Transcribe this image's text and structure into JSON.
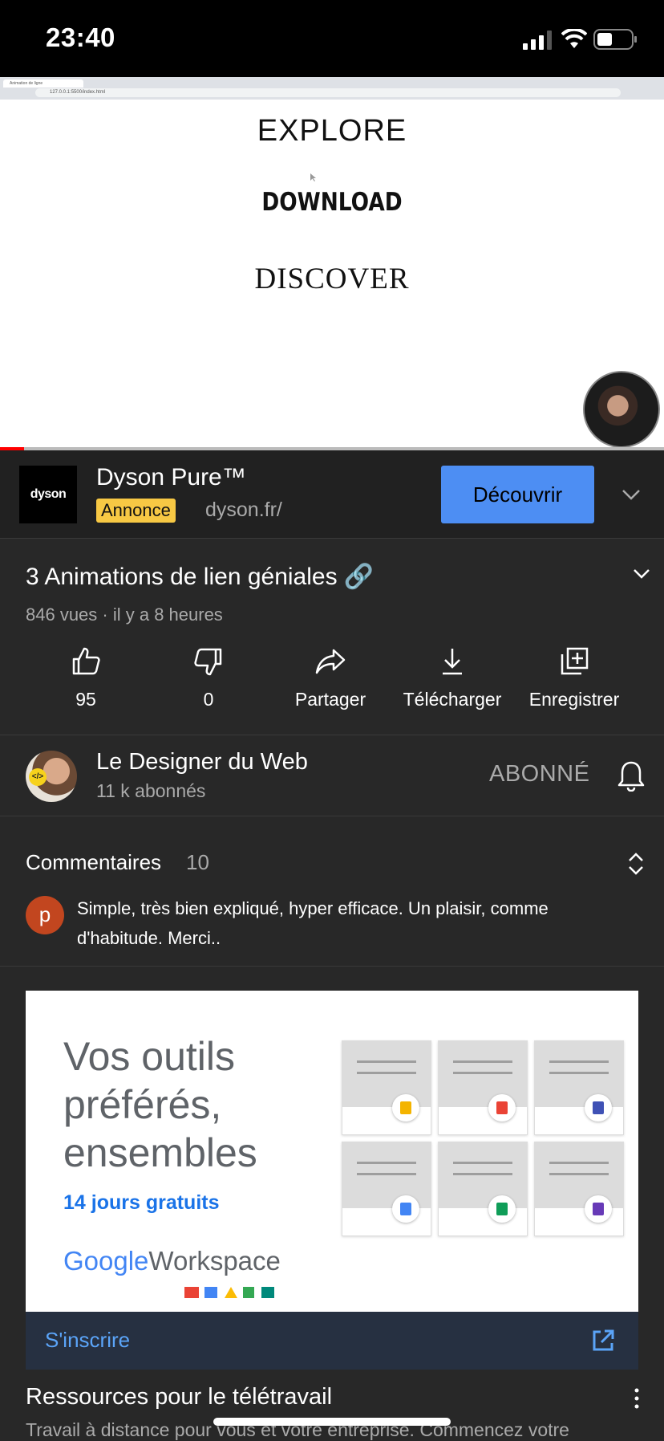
{
  "status_bar": {
    "time": "23:40"
  },
  "video": {
    "browser_tab": "Animation de ligne",
    "browser_url": "127.0.0.1:5500/index.html",
    "lines": [
      "EXPLORE",
      "DOWNLOAD",
      "DISCOVER"
    ],
    "progress": 0.036
  },
  "ad": {
    "logo_text": "dyson",
    "title": "Dyson Pure™",
    "badge": "Annonce",
    "url": "dyson.fr/",
    "cta": "Découvrir"
  },
  "video_info": {
    "title": "3 Animations de lien géniales 🔗",
    "meta": "846 vues · il y a 8 heures"
  },
  "actions": [
    {
      "icon": "thumbs-up-icon",
      "label": "95"
    },
    {
      "icon": "thumbs-down-icon",
      "label": "0"
    },
    {
      "icon": "share-icon",
      "label": "Partager"
    },
    {
      "icon": "download-icon",
      "label": "Télécharger"
    },
    {
      "icon": "save-icon",
      "label": "Enregistrer"
    }
  ],
  "channel": {
    "name": "Le Designer du Web",
    "subscribers": "11 k abonnés",
    "subscribe_state": "ABONNÉ"
  },
  "comments": {
    "title": "Commentaires",
    "count": "10",
    "first": {
      "avatar_letter": "p",
      "text": "Simple, très bien expliqué, hyper efficace. Un plaisir, comme d'habitude. Merci.."
    }
  },
  "promo": {
    "headline": "Vos outils préférés, ensembles",
    "trial": "14 jours gratuits",
    "brand_google": "Google",
    "brand_product": "Workspace",
    "cta": "S'inscrire",
    "tile_colors": [
      "#f4b400",
      "#ea4335",
      "#3f51b5",
      "#4285f4",
      "#0f9d58",
      "#673ab7"
    ]
  },
  "resource": {
    "title": "Ressources pour le télétravail",
    "subtitle": "Travail à distance pour vous et votre entreprise. Commencez votre"
  }
}
